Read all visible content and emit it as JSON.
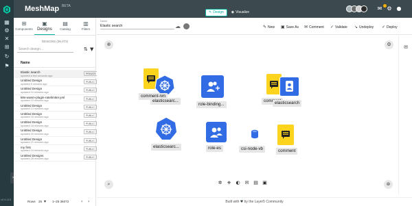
{
  "app": {
    "title": "MeshMap",
    "beta": "BETA",
    "version": "v0.6.115"
  },
  "mode_toggle": [
    {
      "label": "Design",
      "icon": "design-icon",
      "active": true
    },
    {
      "label": "Visualize",
      "icon": "eye-icon",
      "active": false
    }
  ],
  "panel": {
    "tabs": [
      {
        "label": "Components",
        "icon": "components-icon"
      },
      {
        "label": "Designs",
        "icon": "designs-icon",
        "active": true
      },
      {
        "label": "Catalog",
        "icon": "catalog-icon"
      },
      {
        "label": "Filters",
        "icon": "filters-icon"
      }
    ],
    "designs_count": "DESIGNS (36,072)",
    "search_placeholder": "Search design...",
    "list_header": "Name",
    "rows": [
      {
        "name": "Elastic search",
        "sub": "updated a few seconds ago",
        "badge": "PRIVATE"
      },
      {
        "name": "Untitled Design",
        "sub": "updated 5 minutes ago",
        "badge": "PUBLIC"
      },
      {
        "name": "Untitled Design",
        "sub": "updated 10 minutes ago",
        "badge": "PUBLIC"
      },
      {
        "name": "k8s-wasm-plugin-ratelimiter.yml",
        "sub": "updated 10 minutes ago",
        "badge": "PUBLIC"
      },
      {
        "name": "Untitled Design",
        "sub": "updated 14 minutes ago",
        "badge": "PUBLIC"
      },
      {
        "name": "Untitled Design",
        "sub": "updated 16 minutes ago",
        "badge": "PUBLIC"
      },
      {
        "name": "Untitled Design",
        "sub": "updated 18 minutes ago",
        "badge": "PUBLIC"
      },
      {
        "name": "Untitled Design",
        "sub": "updated 20 minutes ago",
        "badge": "PUBLIC"
      },
      {
        "name": "Untitled Design",
        "sub": "updated 21 minutes ago",
        "badge": "PUBLIC"
      },
      {
        "name": "my first",
        "sub": "updated 24 minutes ago",
        "badge": "PUBLIC"
      },
      {
        "name": "Untitled Designs",
        "sub": "updated 28 minutes ago",
        "badge": "PUBLIC"
      }
    ],
    "pager": {
      "rows_label": "Rows",
      "rows_value": "25",
      "range": "1–25 36072"
    }
  },
  "toolbar": {
    "name_label": "Name",
    "name_value": "Elastic search",
    "actions": [
      {
        "label": "New",
        "icon": "pencil-icon"
      },
      {
        "label": "Save As",
        "icon": "save-icon"
      },
      {
        "label": "Comment",
        "icon": "comment-icon"
      },
      {
        "label": "Validate",
        "icon": "check-icon"
      },
      {
        "label": "Undeploy",
        "icon": "undeploy-icon"
      },
      {
        "label": "Deploy",
        "icon": "deploy-icon"
      }
    ]
  },
  "canvas": {
    "nodes": [
      {
        "label": "comment-nm",
        "icon": "comment-icon"
      },
      {
        "label": "elasticsearc...",
        "icon": "elasticsearch-icon"
      },
      {
        "label": "role-binding...",
        "icon": "role-binding-icon"
      },
      {
        "label": "comment",
        "icon": "comment-icon"
      },
      {
        "label": "elasticsearch",
        "icon": "elasticsearch-icon"
      },
      {
        "label": "elasticsearc...",
        "icon": "elasticsearch-icon"
      },
      {
        "label": "role-es",
        "icon": "role-icon"
      },
      {
        "label": "csi-node-vb",
        "icon": "csi-node-icon"
      },
      {
        "label": "comment",
        "icon": "comment-icon"
      }
    ]
  },
  "footer": {
    "text_before": "Built with",
    "text_after": "by the Layer5 Community"
  },
  "colors": {
    "accent": "#00b39f",
    "header": "#3c494e",
    "rail": "#273a40",
    "k8s_blue": "#326ce5",
    "comment_yellow": "#fcd31d"
  }
}
